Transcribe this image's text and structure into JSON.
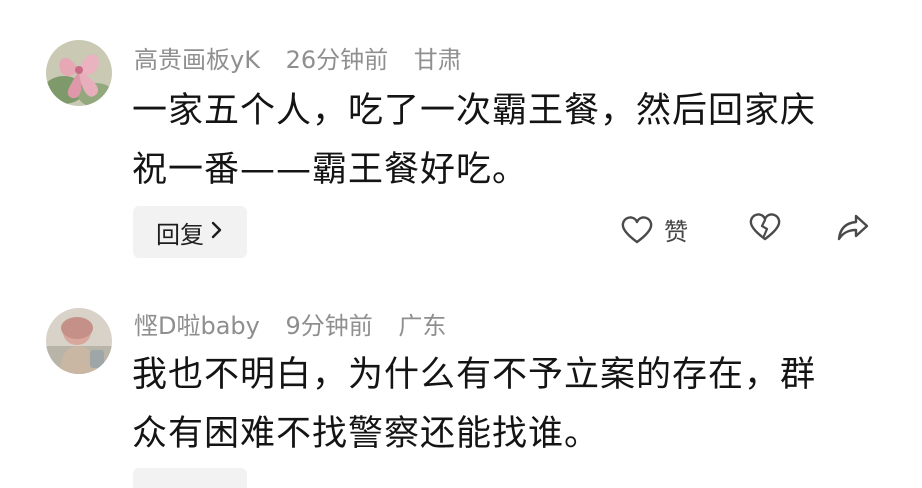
{
  "comments": [
    {
      "username": "高贵画板yK",
      "time": "26分钟前",
      "location": "甘肃",
      "text_lines": [
        "一家五个人，吃了一次霸王餐，然后回家庆",
        "祝一番——霸王餐好吃。"
      ],
      "avatar_icon": "flower-avatar",
      "reply_label": "回复",
      "like_label": "赞"
    },
    {
      "username": "悭D啦baby",
      "time": "9分钟前",
      "location": "广东",
      "text_lines": [
        "我也不明白，为什么有不予立案的存在，群",
        "众有困难不找警察还能找谁。"
      ],
      "avatar_icon": "person-avatar"
    }
  ],
  "icons": {
    "reply_chevron": "chevron-right-icon",
    "like": "heart-outline-icon",
    "dislike": "broken-heart-icon",
    "share": "share-arrow-icon"
  }
}
